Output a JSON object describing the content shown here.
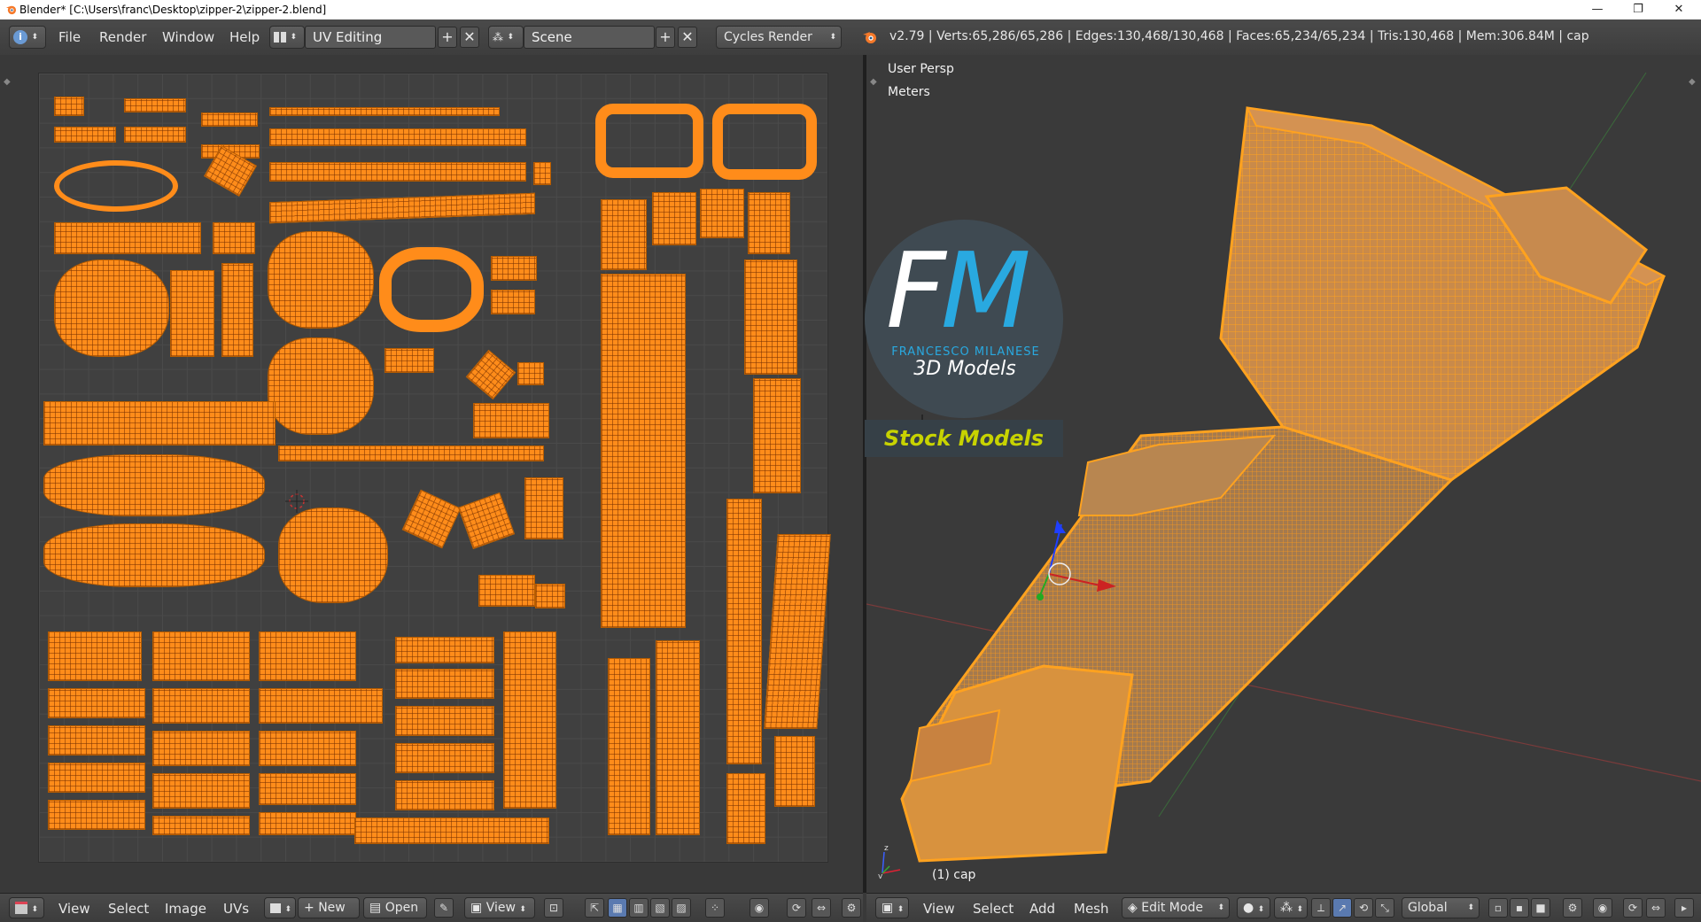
{
  "window": {
    "title": "Blender* [C:\\Users\\franc\\Desktop\\zipper-2\\zipper-2.blend]",
    "minimize": "—",
    "maximize": "❐",
    "close": "✕"
  },
  "infobar": {
    "editor_icon": "i",
    "menus": [
      "File",
      "Render",
      "Window",
      "Help"
    ],
    "layout_name": "UV Editing",
    "scene_name": "Scene",
    "render_engine": "Cycles Render",
    "stats": "v2.79 | Verts:65,286/65,286 | Edges:130,468/130,468 | Faces:65,234/65,234 | Tris:130,468 | Mem:306.84M | cap"
  },
  "viewport": {
    "view_name": "User Persp",
    "units": "Meters",
    "object_label": "(1) cap"
  },
  "watermark": {
    "letter_f": "F",
    "letter_m": "M",
    "subtitle": "FRANCESCO MILANESE",
    "tagline": "3D Models",
    "badge": "Stock Models"
  },
  "uv_footer": {
    "menus": [
      "View",
      "Select",
      "Image",
      "UVs"
    ],
    "new_label": "New",
    "open_label": "Open",
    "view_label": "View"
  },
  "vp_footer": {
    "menus": [
      "View",
      "Select",
      "Add",
      "Mesh"
    ],
    "mode": "Edit Mode",
    "orientation": "Global"
  },
  "colors": {
    "accent_orange": "#ff8c1a",
    "fm_blue": "#29a9e0",
    "stock_yellow": "#c8d300"
  }
}
